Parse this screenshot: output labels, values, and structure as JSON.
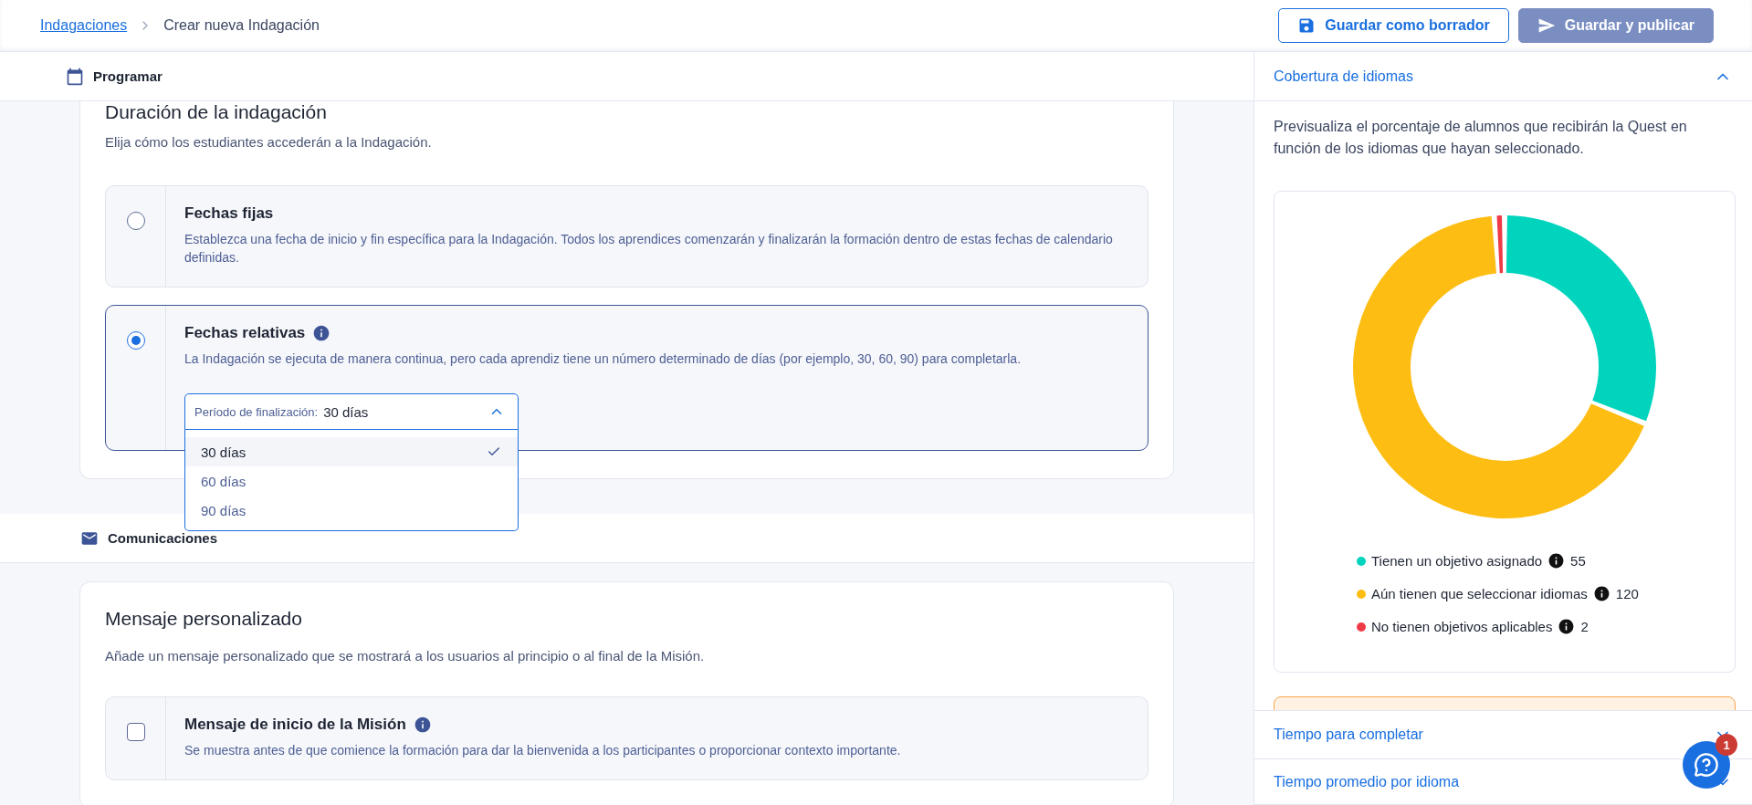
{
  "breadcrumb": {
    "link": "Indagaciones",
    "current": "Crear nueva Indagación"
  },
  "actions": [
    {
      "label": "Guardar como borrador",
      "kind": "outline"
    },
    {
      "label": "Guardar y publicar",
      "kind": "filled"
    }
  ],
  "schedule": {
    "title": "Programar",
    "card_title": "Duración de la indagación",
    "card_subtitle": "Elija cómo los estudiantes accederán a la Indagación.",
    "options": [
      {
        "title": "Fechas fijas",
        "description": "Establezca una fecha de inicio y fin específica para la Indagación. Todos los aprendices comenzarán y finalizarán la formación dentro de estas fechas de calendario definidas.",
        "selected": false,
        "info": false
      },
      {
        "title": "Fechas relativas",
        "description": "La Indagación se ejecuta de manera continua, pero cada aprendiz tiene un número determinado de días (por ejemplo, 30, 60, 90) para completarla.",
        "selected": true,
        "info": true
      }
    ],
    "dropdown": {
      "label": "Período de finalización:",
      "value": "30 días",
      "expanded": true,
      "options": [
        {
          "label": "30 días",
          "selected": true
        },
        {
          "label": "60 días",
          "selected": false
        },
        {
          "label": "90 días",
          "selected": false
        }
      ]
    }
  },
  "communications": {
    "title": "Comunicaciones",
    "card_title": "Mensaje personalizado",
    "card_subtitle": "Añade un mensaje personalizado que se mostrará a los usuarios al principio o al final de la Misión.",
    "options": [
      {
        "title": "Mensaje de inicio de la Misión",
        "description": "Se muestra antes de que comience la formación para dar la bienvenida a los participantes o proporcionar contexto importante.",
        "checked": false,
        "info": true
      }
    ]
  },
  "coverage": {
    "title": "Cobertura de idiomas",
    "expanded": true,
    "description": "Previsualiza el porcentaje de alumnos que recibirán la Quest en función de los idiomas que hayan seleccionado.",
    "legend": [
      {
        "count": "55",
        "color": "#00d4bd"
      },
      {
        "count": "120",
        "color": "#fdbd13"
      },
      {
        "count": "2",
        "color": "#ef3a47"
      }
    ],
    "chart_data": {
      "type": "donut",
      "categories": [
        "Tienen un objetivo asignado",
        "Aún tienen que seleccionar idiomas",
        "No tienen objetivos aplicables"
      ],
      "values": [
        31.1,
        67.8,
        1.1
      ]
    }
  },
  "accordions": [
    {
      "title": "Tiempo para completar",
      "expanded": false
    },
    {
      "title": "Tiempo promedio por idioma",
      "expanded": false
    }
  ],
  "help": {
    "badge": "1"
  }
}
